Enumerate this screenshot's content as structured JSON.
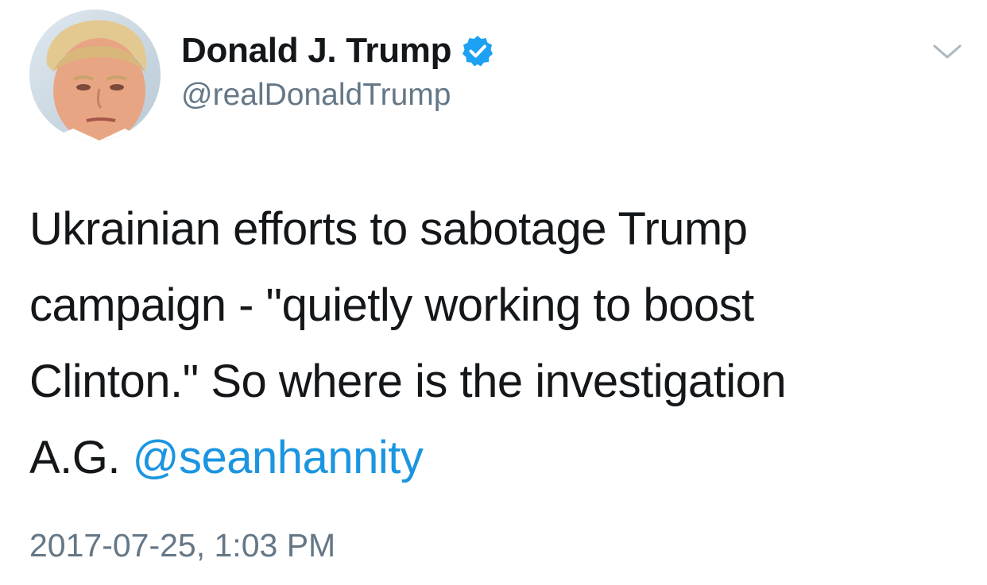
{
  "author": {
    "display_name": "Donald J. Trump",
    "handle": "@realDonaldTrump",
    "verified": true,
    "avatar_icon": "profile-photo"
  },
  "tweet": {
    "lines": [
      "Ukrainian efforts to sabotage Trump",
      "campaign - \"quietly working to boost",
      "Clinton.\" So where is the investigation",
      "A.G. "
    ],
    "mention": "@seanhannity",
    "timestamp": "2017-07-25, 1:03 PM"
  },
  "icons": {
    "verified": "verified-badge-icon",
    "menu": "chevron-down-icon"
  },
  "colors": {
    "text": "#14171a",
    "secondary": "#657786",
    "link": "#1b95e0",
    "verified": "#1da1f2"
  }
}
